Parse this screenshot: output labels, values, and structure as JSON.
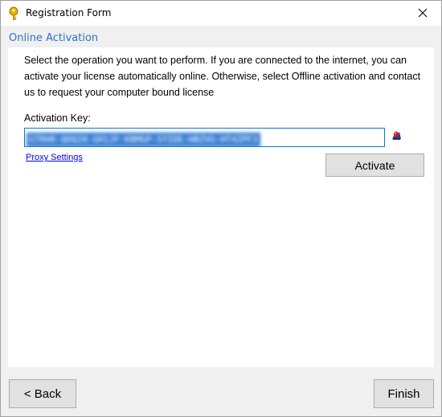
{
  "window": {
    "title": "Registration Form"
  },
  "header": {
    "section_title": "Online Activation"
  },
  "main": {
    "instructions": "Select the operation you want to perform. If you are connected to the internet, you can activate your license automatically online. Otherwise, select Offline activation and contact us to request your computer bound license",
    "activation_key_label": "Activation Key:",
    "activation_key_value": "GTRH0-QDQ20-GH1JF-KBMGP-SYIDE-HBZVG-HT4ZPF3",
    "proxy_settings_label": "Proxy Settings",
    "activate_label": "Activate"
  },
  "footer": {
    "back_label": "< Back",
    "finish_label": "Finish"
  },
  "icons": {
    "app": "key-icon",
    "paste": "paste-key-icon",
    "close": "close-icon"
  },
  "colors": {
    "accent_link": "#2a72c4",
    "selection": "#3a7fd5",
    "input_border": "#0078d7"
  }
}
